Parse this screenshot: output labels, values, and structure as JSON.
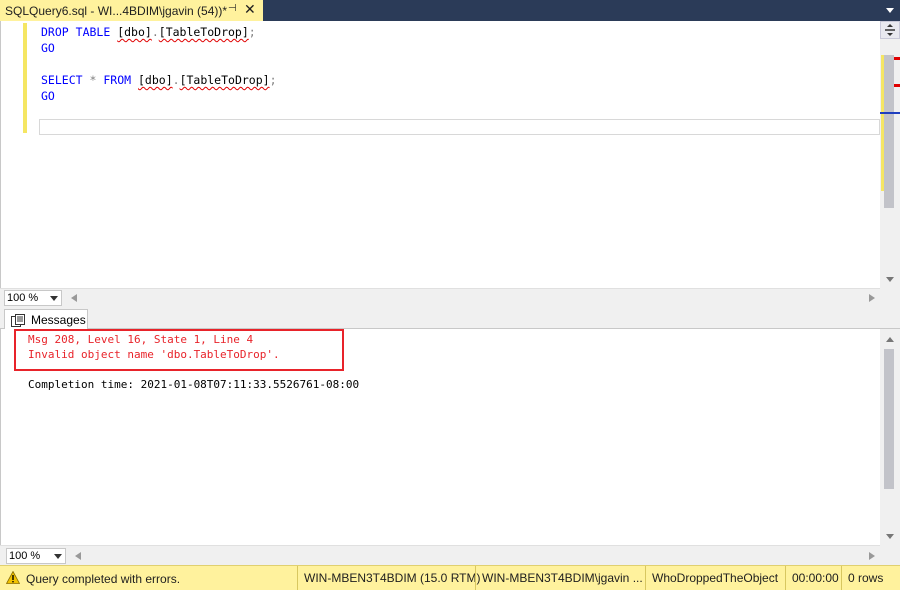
{
  "tab": {
    "title": "SQLQuery6.sql - WI...4BDIM\\jgavin (54))*",
    "pin_icon": "pin-icon",
    "close_glyph": "✕"
  },
  "editor": {
    "lines": [
      [
        {
          "t": "DROP",
          "c": "kw"
        },
        {
          "t": " ",
          "c": "id"
        },
        {
          "t": "TABLE",
          "c": "kw"
        },
        {
          "t": " ",
          "c": "id"
        },
        {
          "t": "[dbo]",
          "c": "id squig"
        },
        {
          "t": ".",
          "c": "pun"
        },
        {
          "t": "[TableToDrop]",
          "c": "id squig"
        },
        {
          "t": ";",
          "c": "pun"
        }
      ],
      [
        {
          "t": "GO",
          "c": "kw"
        }
      ],
      [],
      [
        {
          "t": "SELECT",
          "c": "kw"
        },
        {
          "t": " ",
          "c": "id"
        },
        {
          "t": "*",
          "c": "pun"
        },
        {
          "t": " ",
          "c": "id"
        },
        {
          "t": "FROM",
          "c": "kw"
        },
        {
          "t": " ",
          "c": "id"
        },
        {
          "t": "[dbo]",
          "c": "id squig"
        },
        {
          "t": ".",
          "c": "pun"
        },
        {
          "t": "[TableToDrop]",
          "c": "id squig"
        },
        {
          "t": ";",
          "c": "pun"
        }
      ],
      [
        {
          "t": "GO",
          "c": "kw"
        }
      ],
      []
    ],
    "zoom": "100 %"
  },
  "results": {
    "tab_label": "Messages",
    "lines": [
      {
        "text": "Msg 208, Level 16, State 1, Line 4",
        "kind": "err"
      },
      {
        "text": "Invalid object name 'dbo.TableToDrop'.",
        "kind": "err"
      },
      {
        "text": "",
        "kind": "ok"
      },
      {
        "text": "Completion time: 2021-01-08T07:11:33.5526761-08:00",
        "kind": "ok"
      }
    ],
    "zoom": "100 %"
  },
  "status": {
    "message": "Query completed with errors.",
    "server": "WIN-MBEN3T4BDIM (15.0 RTM)",
    "user": "WIN-MBEN3T4BDIM\\jgavin ...",
    "database": "WhoDroppedTheObject",
    "elapsed": "00:00:00",
    "rows": "0 rows"
  },
  "colors": {
    "accent_yellow": "#fff29d",
    "tabstrip": "#2b3b58",
    "keyword": "#0000ff",
    "error": "#e8232a"
  }
}
